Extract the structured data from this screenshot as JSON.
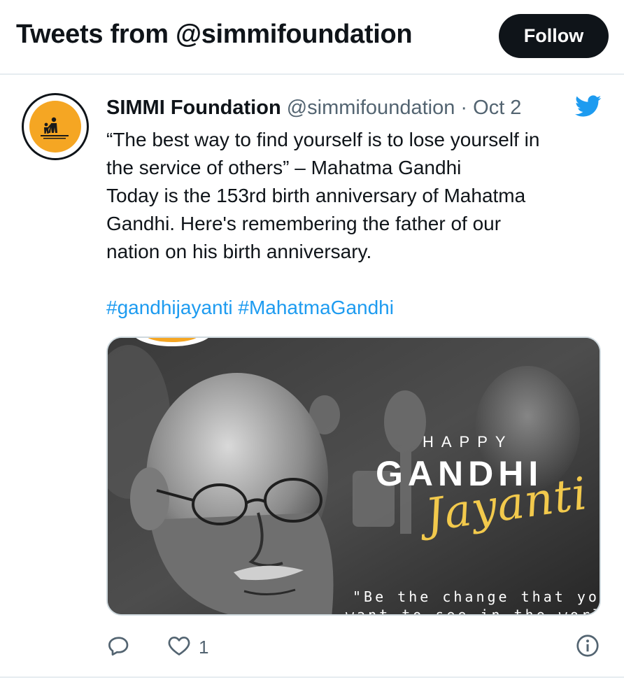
{
  "header": {
    "title": "Tweets from @simmifoundation",
    "follow_label": "Follow"
  },
  "tweet": {
    "author_name": "SIMMI Foundation",
    "author_handle": "@simmifoundation",
    "separator": "·",
    "date": "Oct 2",
    "avatar_icon": "simmi-logo-icon",
    "text_lines": [
      "“The best way to find yourself is to lose yourself in",
      "the service of others” – Mahatma Gandhi",
      "Today is the 153rd birth anniversary of Mahatma",
      "Gandhi. Here's remembering the father of our",
      "nation on his birth anniversary."
    ],
    "hashtags": [
      "#gandhijayanti",
      "#MahatmaGandhi"
    ],
    "media": {
      "happy": "HAPPY",
      "gandhi": "GANDHI",
      "jayanti": "Jayanti",
      "quote_line1": "\"Be the change that you",
      "quote_line2": "want to see in the world\""
    },
    "actions": {
      "reply_icon": "reply-icon",
      "like_icon": "heart-icon",
      "like_count": "1",
      "info_icon": "info-icon"
    }
  },
  "colors": {
    "link": "#1d9bf0",
    "follow_bg": "#0f1419",
    "avatar_bg": "#f5a623",
    "jayanti_gold": "#f2c94c"
  }
}
